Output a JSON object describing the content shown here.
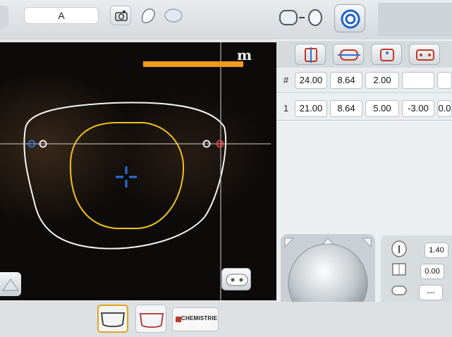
{
  "topbar": {
    "tab_label": "A"
  },
  "logo_text": "m",
  "params": {
    "header_symbol": "#",
    "header_values": [
      "24.00",
      "8.64",
      "2.00",
      "",
      ""
    ],
    "row_label": "1",
    "row_values": [
      "21.00",
      "8.64",
      "5.00",
      "-3.00",
      "0.0"
    ]
  },
  "side_values": {
    "v1": "1.40",
    "v2": "0.00",
    "v3": "---",
    "v4": "---"
  },
  "brand_label": "CHEMISTRIE",
  "colors": {
    "accent_orange": "#f39c1f",
    "lens_yellow": "#f0c21c",
    "blue": "#2f6fd8",
    "red_marker": "#e0473a"
  }
}
